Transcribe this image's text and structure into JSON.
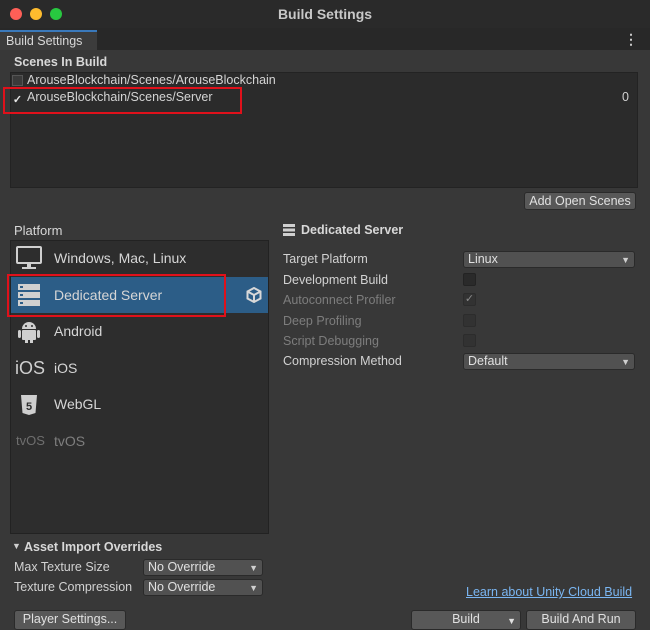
{
  "window": {
    "title": "Build Settings"
  },
  "tabs": [
    {
      "label": "Build Settings"
    }
  ],
  "scenes": {
    "header": "Scenes In Build",
    "items": [
      {
        "path": "ArouseBlockchain/Scenes/ArouseBlockchain",
        "checked": false,
        "index": ""
      },
      {
        "path": "ArouseBlockchain/Scenes/Server",
        "checked": true,
        "index": "0"
      }
    ],
    "add_open_scenes_label": "Add Open Scenes"
  },
  "platform": {
    "header": "Platform",
    "items": [
      {
        "label": "Windows, Mac, Linux",
        "icon": "monitor-icon"
      },
      {
        "label": "Dedicated Server",
        "icon": "server-icon",
        "selected": true
      },
      {
        "label": "Android",
        "icon": "android-icon"
      },
      {
        "label": "iOS",
        "icon": "ios-icon",
        "icon_text": "iOS"
      },
      {
        "label": "WebGL",
        "icon": "html5-icon",
        "icon_text": "5"
      },
      {
        "label": "tvOS",
        "icon": "tvos-icon",
        "icon_text": "tvOS",
        "disabled": true
      }
    ]
  },
  "settings": {
    "title": "Dedicated Server",
    "target_platform": {
      "label": "Target Platform",
      "value": "Linux"
    },
    "development_build": {
      "label": "Development Build"
    },
    "autoconnect_profiler": {
      "label": "Autoconnect Profiler"
    },
    "deep_profiling": {
      "label": "Deep Profiling"
    },
    "script_debugging": {
      "label": "Script Debugging"
    },
    "compression_method": {
      "label": "Compression Method",
      "value": "Default"
    }
  },
  "asset_import": {
    "header": "Asset Import Overrides",
    "max_texture_size": {
      "label": "Max Texture Size",
      "value": "No Override"
    },
    "texture_compression": {
      "label": "Texture Compression",
      "value": "No Override"
    }
  },
  "footer": {
    "learn_link": "Learn about Unity Cloud Build",
    "player_settings": "Player Settings...",
    "build": "Build",
    "build_and_run": "Build And Run"
  },
  "colors": {
    "accent": "#2c5d87",
    "highlight": "#e0111b",
    "link": "#7ab6f2"
  }
}
